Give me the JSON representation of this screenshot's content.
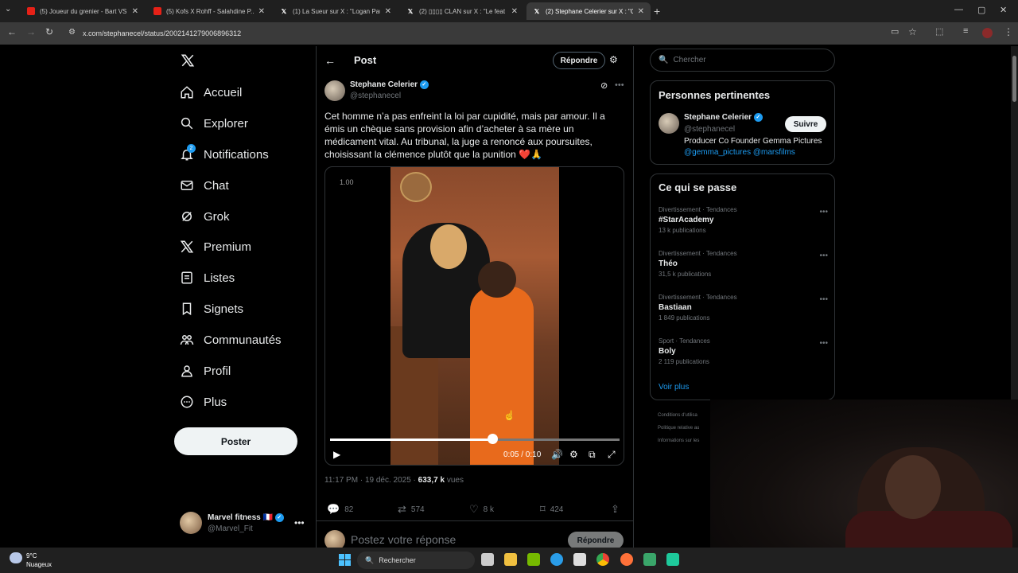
{
  "browser": {
    "tabs": [
      {
        "title": "(5) Joueur du grenier - Bart VS",
        "icon": "youtube-icon"
      },
      {
        "title": "(5) Kofs X Rohff - Salahdine P...",
        "icon": "youtube-icon"
      },
      {
        "title": "(1) La Sueur sur X : \"Logan Paul",
        "icon": "x-icon"
      },
      {
        "title": "(2) ▯▯▯▯ CLAN sur X : \"Le feat",
        "icon": "x-icon"
      },
      {
        "title": "(2) Stephane Celerier sur X : \"Ce",
        "icon": "x-icon",
        "active": true
      }
    ],
    "url": "x.com/stephanecel/status/2002141279006896312"
  },
  "sidebar": {
    "items": [
      {
        "label": "Accueil",
        "icon": "home-icon"
      },
      {
        "label": "Explorer",
        "icon": "search-icon"
      },
      {
        "label": "Notifications",
        "icon": "bell-icon",
        "badge": "2"
      },
      {
        "label": "Chat",
        "icon": "mail-icon"
      },
      {
        "label": "Grok",
        "icon": "grok-icon"
      },
      {
        "label": "Premium",
        "icon": "x-logo-icon"
      },
      {
        "label": "Listes",
        "icon": "list-icon"
      },
      {
        "label": "Signets",
        "icon": "bookmark-icon"
      },
      {
        "label": "Communautés",
        "icon": "communities-icon"
      },
      {
        "label": "Profil",
        "icon": "person-icon"
      },
      {
        "label": "Plus",
        "icon": "more-circle-icon"
      }
    ],
    "post_button": "Poster",
    "account": {
      "name": "Marvel fitness 🇫🇷",
      "handle": "@Marvel_Fit"
    }
  },
  "post": {
    "header_title": "Post",
    "reply_button": "Répondre",
    "author_name": "Stephane Celerier",
    "author_handle": "@stephanecel",
    "text": "Cet homme n’a pas enfreint la loi par cupidité, mais par amour. Il a émis un chèque sans provision afin d’acheter à sa mère un médicament vital. Au tribunal, la juge a renoncé aux poursuites, choisissant la clémence plutôt que la punition ❤️🙏",
    "video": {
      "speed": "1.00",
      "time": "0:05 / 0:10",
      "progress": 0.56
    },
    "timestamp": "11:17 PM · 19 déc. 2025 · ",
    "views": "633,7 k",
    "views_suffix": " vues",
    "stats": {
      "replies": "82",
      "reposts": "574",
      "likes": "8 k",
      "bookmarks": "424"
    },
    "reply_placeholder": "Postez votre réponse",
    "reply_submit": "Répondre"
  },
  "right": {
    "search_placeholder": "Chercher",
    "relevant_title": "Personnes pertinentes",
    "relevant": {
      "name": "Stephane Celerier",
      "handle": "@stephanecel",
      "bio": "Producer Co Founder Gemma Pictures",
      "links": "@gemma_pictures @marsfilms",
      "follow": "Suivre"
    },
    "trends_title": "Ce qui se passe",
    "trends": [
      {
        "category": "Divertissement · Tendances",
        "name": "#StarAcademy",
        "count": "13 k publications"
      },
      {
        "category": "Divertissement · Tendances",
        "name": "Théo",
        "count": "31,5 k publications"
      },
      {
        "category": "Divertissement · Tendances",
        "name": "Bastiaan",
        "count": "1 849 publications"
      },
      {
        "category": "Sport · Tendances",
        "name": "Boly",
        "count": "2 119 publications"
      }
    ],
    "see_more": "Voir plus",
    "footer": [
      "Conditions d'utilisa",
      "Politique relative au",
      "Informations sur les"
    ]
  },
  "taskbar": {
    "weather_temp": "9°C",
    "weather_desc": "Nuageux",
    "search": "Rechercher"
  },
  "colors": {
    "accent": "#1d9bf0",
    "background": "#000000",
    "border": "#2f3336"
  }
}
